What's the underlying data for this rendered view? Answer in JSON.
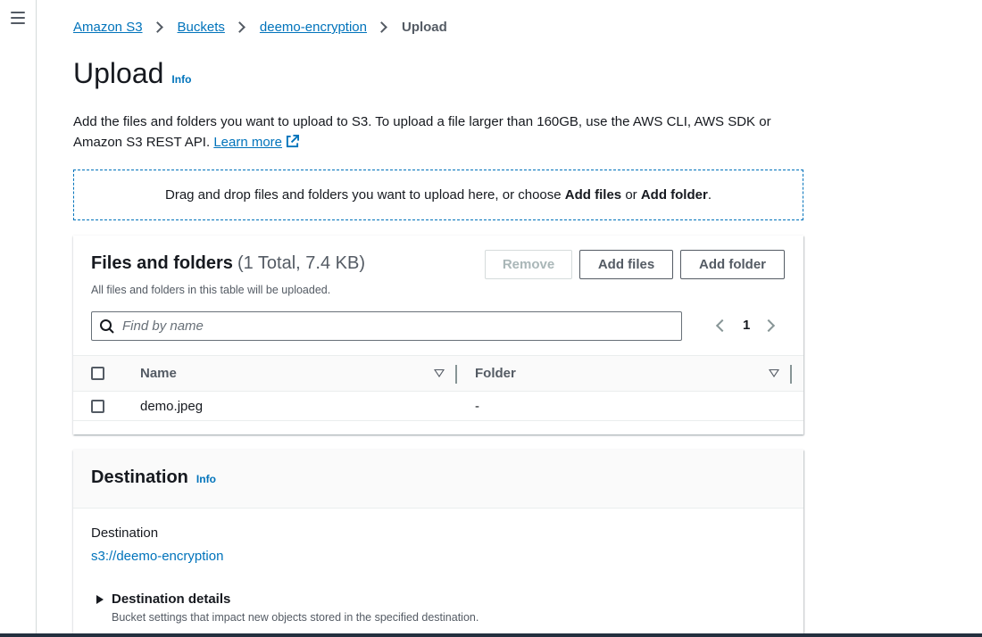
{
  "nav": {
    "menu_icon": "hamburger-menu-icon"
  },
  "breadcrumb": {
    "items": [
      "Amazon S3",
      "Buckets",
      "deemo-encryption"
    ],
    "current": "Upload"
  },
  "page": {
    "title": "Upload",
    "info_label": "Info",
    "description": "Add the files and folders you want to upload to S3. To upload a file larger than 160GB, use the AWS CLI, AWS SDK or Amazon S3 REST API.",
    "learn_more": "Learn more",
    "learn_more_icon": "external-link-icon"
  },
  "dropzone": {
    "prefix": "Drag and drop files and folders you want to upload here, or choose",
    "add_files": "Add files",
    "or": "or",
    "add_folder": "Add folder",
    "suffix": "."
  },
  "files_panel": {
    "title": "Files and folders",
    "count": "(1 Total, 7.4 KB)",
    "subtitle": "All files and folders in this table will be uploaded.",
    "remove_button": "Remove",
    "add_files_button": "Add files",
    "add_folder_button": "Add folder",
    "search_placeholder": "Find by name",
    "search_icon": "search-icon",
    "page_number": "1",
    "columns": [
      "Name",
      "Folder"
    ],
    "rows": [
      {
        "name": "demo.jpeg",
        "folder": "-"
      }
    ]
  },
  "destination_panel": {
    "title": "Destination",
    "info_label": "Info",
    "label": "Destination",
    "value": "s3://deemo-encryption",
    "details_title": "Destination details",
    "details_subtitle": "Bucket settings that impact new objects stored in the specified destination."
  },
  "colors": {
    "link": "#0073bb",
    "text": "#16191f",
    "muted": "#545b64",
    "border": "#eaeded"
  }
}
